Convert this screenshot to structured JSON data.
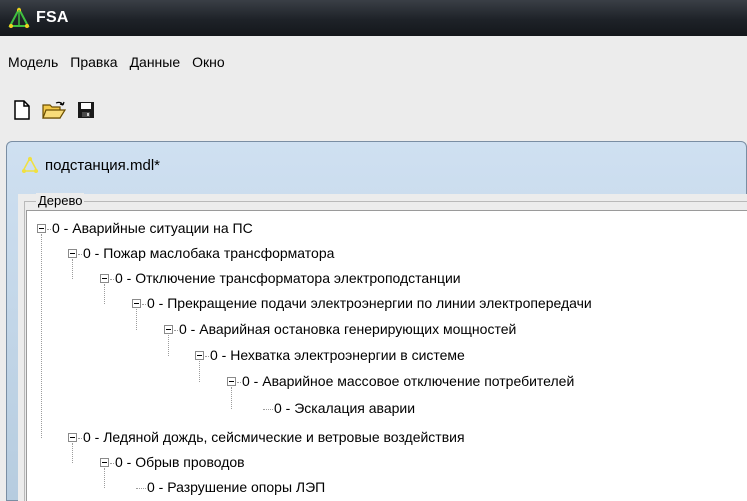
{
  "window": {
    "title": "FSA"
  },
  "menu": {
    "items": [
      "Модель",
      "Правка",
      "Данные",
      "Окно"
    ]
  },
  "toolbar": {
    "buttons": [
      "new-file-icon",
      "open-folder-icon",
      "save-disk-icon"
    ]
  },
  "document": {
    "title": "подстанция.mdl*"
  },
  "panel": {
    "group_label": "Дерево"
  },
  "tree": {
    "nodes": [
      {
        "label": "0 - Аварийные ситуации на ПС"
      },
      {
        "label": "0 - Пожар маслобака трансформатора"
      },
      {
        "label": "0 - Отключение трансформатора электроподстанции"
      },
      {
        "label": "0 - Прекращение подачи электроэнергии по линии электропередачи"
      },
      {
        "label": "0 - Аварийная остановка генерирующих мощностей"
      },
      {
        "label": "0 - Нехватка электроэнергии в системе"
      },
      {
        "label": "0 - Аварийное массовое отключение потребителей"
      },
      {
        "label": "0 - Эскалация аварии"
      },
      {
        "label": "0 - Ледяной дождь, сейсмические и ветровые воздействия"
      },
      {
        "label": "0 - Обрыв проводов"
      },
      {
        "label": "0 - Разрушение опоры ЛЭП"
      }
    ]
  }
}
